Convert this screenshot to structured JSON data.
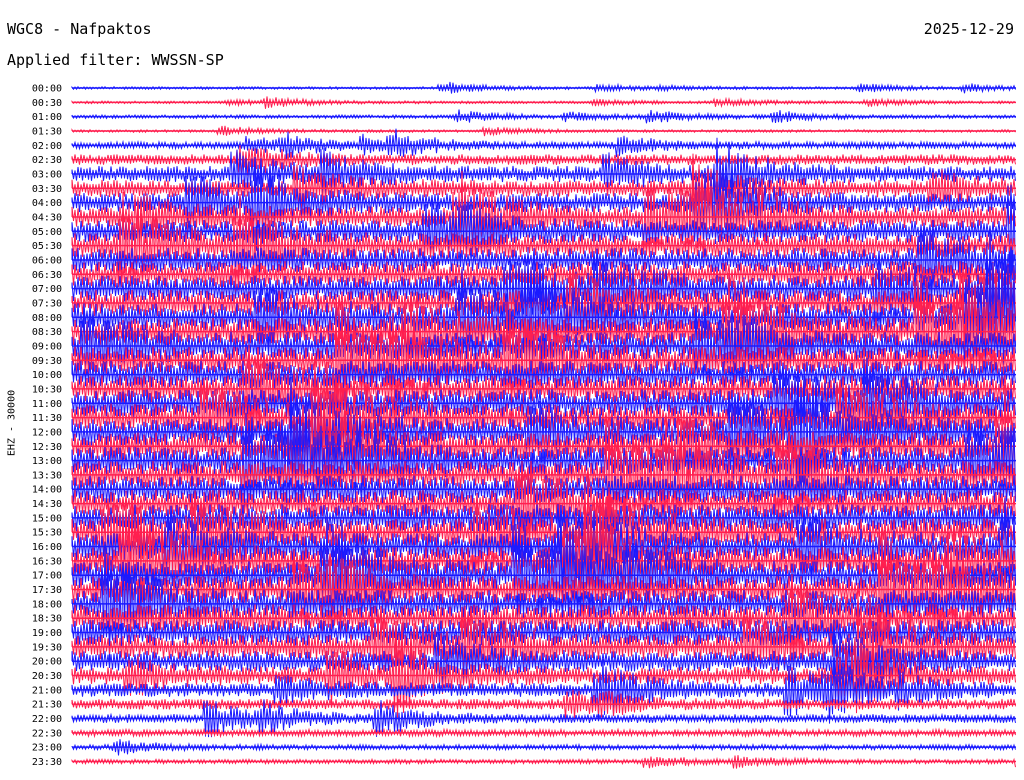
{
  "header": {
    "title": "WGC8 - Nafpaktos",
    "date": "2025-12-29",
    "filter": "Applied filter: WWSSN-SP"
  },
  "axis": {
    "ylabel": "EHZ - 30000"
  },
  "colors": {
    "trace_a": "#1a1aff",
    "trace_b": "#ff1f4f",
    "background": "#ffffff"
  },
  "chart_data": {
    "type": "line",
    "title": "WGC8 - Nafpaktos",
    "subtitle": "Applied filter: WWSSN-SP",
    "ylabel": "EHZ - 30000",
    "xlabel": "",
    "grid": false,
    "legend": "none",
    "rows": [
      "00:00",
      "00:30",
      "01:00",
      "01:30",
      "02:00",
      "02:30",
      "03:00",
      "03:30",
      "04:00",
      "04:30",
      "05:00",
      "05:30",
      "06:00",
      "06:30",
      "07:00",
      "07:30",
      "08:00",
      "08:30",
      "09:00",
      "09:30",
      "10:00",
      "10:30",
      "11:00",
      "11:30",
      "12:00",
      "12:30",
      "13:00",
      "13:30",
      "14:00",
      "14:30",
      "15:00",
      "15:30",
      "16:00",
      "16:30",
      "17:00",
      "17:30",
      "18:00",
      "18:30",
      "19:00",
      "19:30",
      "20:00",
      "20:30",
      "21:00",
      "21:30",
      "22:00",
      "22:30",
      "23:00",
      "23:30"
    ],
    "row_colors": [
      "blue",
      "red"
    ],
    "relative_amplitude": [
      0.15,
      0.15,
      0.2,
      0.15,
      0.4,
      0.6,
      0.9,
      1.0,
      1.1,
      1.2,
      1.3,
      1.4,
      1.4,
      1.5,
      1.5,
      1.5,
      1.6,
      1.6,
      1.6,
      1.6,
      1.6,
      1.6,
      1.6,
      1.6,
      1.6,
      1.6,
      1.6,
      1.6,
      1.6,
      1.6,
      1.6,
      1.6,
      1.6,
      1.6,
      1.6,
      1.6,
      1.6,
      1.6,
      1.5,
      1.4,
      1.2,
      1.0,
      0.8,
      0.6,
      0.5,
      0.4,
      0.3,
      0.25
    ]
  }
}
